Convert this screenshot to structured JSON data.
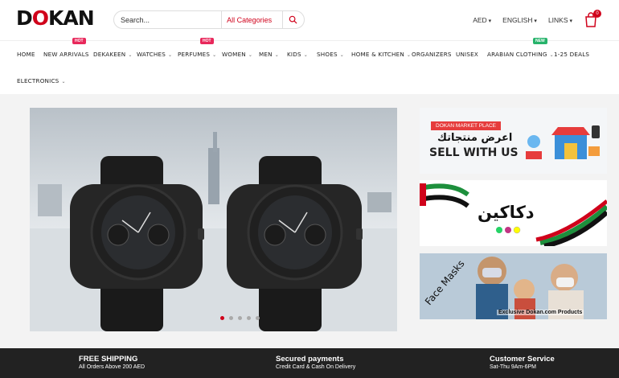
{
  "header": {
    "logo": "DOKAN",
    "search": {
      "placeholder": "Search...",
      "category": "All Categories"
    },
    "currency": "AED",
    "language": "ENGLISH",
    "links": "LINKS",
    "cart_count": "0"
  },
  "nav": {
    "items": [
      {
        "label": "HOME"
      },
      {
        "label": "NEW ARRIVALS",
        "tag": "HOT"
      },
      {
        "label": "DEKAKEEN"
      },
      {
        "label": "WATCHES"
      },
      {
        "label": "PERFUMES",
        "tag": "HOT"
      },
      {
        "label": "WOMEN"
      },
      {
        "label": "MEN"
      },
      {
        "label": "KIDS"
      },
      {
        "label": "SHOES"
      },
      {
        "label": "HOME & KITCHEN"
      },
      {
        "label": "ORGANIZERS"
      },
      {
        "label": "UNISEX"
      },
      {
        "label": "ARABIAN CLOTHING",
        "tag": "NEW"
      },
      {
        "label": "1-25 DEALS"
      },
      {
        "label": "ELECTRONICS"
      }
    ]
  },
  "banners": {
    "market": {
      "tag": "DOKAN MARKET PLACE",
      "arabic": "اعرض منتجاتك",
      "sell": "SELL WITH US"
    },
    "dakakeen": {
      "arabic": "دكاكين"
    },
    "masks": {
      "title": "Face Masks",
      "caption": "Exclusive Dokan.com Products"
    }
  },
  "slider": {
    "active_slide": 1,
    "slide_count": 5
  },
  "footer": {
    "features": [
      {
        "title": "FREE SHIPPING",
        "sub": "All Orders Above 200 AED"
      },
      {
        "title": "Secured payments",
        "sub": "Credit Card & Cash On Delivery"
      },
      {
        "title": "Customer Service",
        "sub": "Sat-Thu 9Am-6PM"
      }
    ]
  },
  "colors": {
    "accent": "#d0021b",
    "hot": "#e8285b",
    "new": "#27b36b",
    "footer": "#222222"
  }
}
